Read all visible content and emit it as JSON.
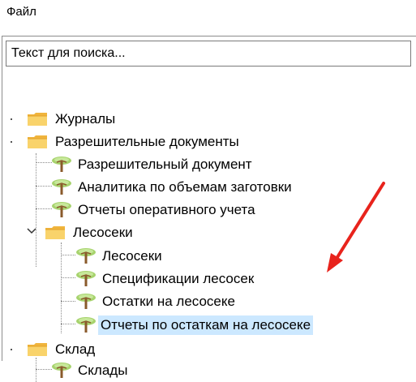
{
  "menu": {
    "file": "Файл"
  },
  "search": {
    "placeholder": "Текст для поиска..."
  },
  "tree": {
    "journals": "Журналы",
    "permits": "Разрешительные документы",
    "permit_doc": "Разрешительный документ",
    "analytics": "Аналитика по объемам заготовки",
    "reports": "Отчеты оперативного учета",
    "cutting_areas": "Лесосеки",
    "cutting_areas_item": "Лесосеки",
    "specs": "Спецификации лесосек",
    "remains": "Остатки на лесосеке",
    "remains_reports": "Отчеты по остаткам на лесосеке",
    "warehouse": "Склад",
    "warehouses": "Склады"
  },
  "annotation": {
    "arrow_color": "#e8231c"
  },
  "colors": {
    "selection": "#cce8ff",
    "folder": "#f7c95a",
    "leaf_canopy": "#a7d36e",
    "leaf_trunk": "#8a5a2b"
  }
}
